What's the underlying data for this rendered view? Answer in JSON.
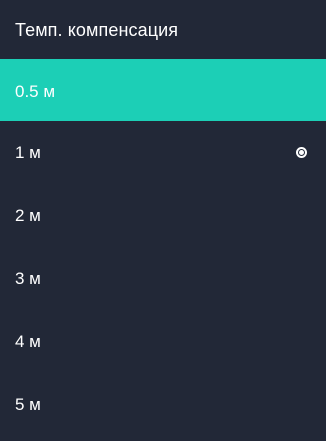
{
  "menu": {
    "title": "Темп. компенсация",
    "items": [
      {
        "label": "0.5 м",
        "highlighted": true,
        "selected": false
      },
      {
        "label": "1 м",
        "highlighted": false,
        "selected": true
      },
      {
        "label": "2 м",
        "highlighted": false,
        "selected": false
      },
      {
        "label": "3 м",
        "highlighted": false,
        "selected": false
      },
      {
        "label": "4 м",
        "highlighted": false,
        "selected": false
      },
      {
        "label": "5 м",
        "highlighted": false,
        "selected": false
      }
    ]
  },
  "colors": {
    "background": "#222837",
    "accent": "#1ccfb6",
    "text": "#ffffff"
  }
}
